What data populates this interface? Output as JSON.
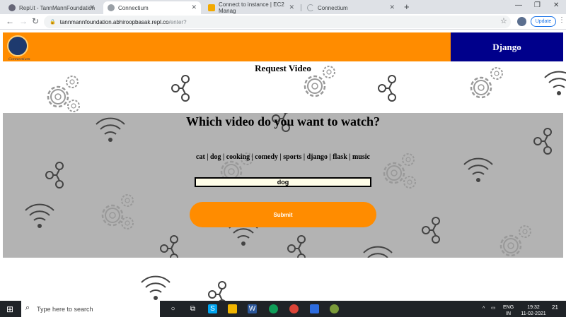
{
  "browser": {
    "tabs": [
      {
        "title": "Repl.it - TannMannFoundation",
        "active": false
      },
      {
        "title": "Connectium",
        "active": true
      },
      {
        "title": "Connect to instance | EC2 Manag",
        "active": false
      },
      {
        "title": "Connectium",
        "active": false
      }
    ],
    "url_host": "tannmannfoundation.abhiroopbasak.repl.co",
    "url_path": "/enter?",
    "update_label": "Update"
  },
  "page": {
    "logo_text": "Connectium",
    "brand": "Django",
    "heading": "Request Video",
    "question": "Which video do you want to watch?",
    "categories": "cat | dog | cooking | comedy | sports | django | flask | music",
    "search_value": "dog",
    "submit_label": "Submit"
  },
  "colors": {
    "nav_orange": "#ff8c00",
    "brand_navy": "#00008b",
    "panel_grey": "#b3b3b3"
  },
  "taskbar": {
    "search_placeholder": "Type here to search",
    "lang_top": "ENG",
    "lang_bottom": "IN",
    "time": "19:32",
    "date": "11-02-2021",
    "notification_count": "21"
  }
}
